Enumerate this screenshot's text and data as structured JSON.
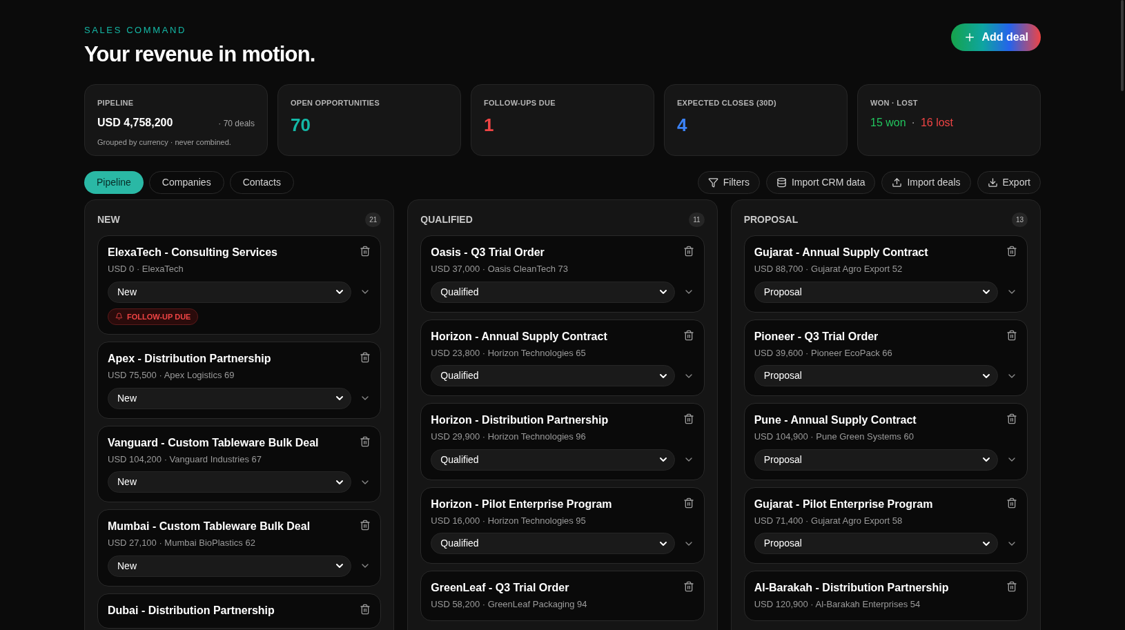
{
  "header": {
    "eyebrow": "SALES COMMAND",
    "title": "Your revenue in motion.",
    "add_button": "Add deal"
  },
  "stats": [
    {
      "kind": "pipeline",
      "label": "PIPELINE",
      "value": "USD 4,758,200",
      "aside": "· 70 deals",
      "note": "Grouped by currency · never combined."
    },
    {
      "kind": "number",
      "label": "OPEN OPPORTUNITIES",
      "value": "70",
      "color": "#14b8a6"
    },
    {
      "kind": "number",
      "label": "FOLLOW-UPS DUE",
      "value": "1",
      "color": "#ef4444"
    },
    {
      "kind": "number",
      "label": "EXPECTED CLOSES (30D)",
      "value": "4",
      "color": "#3b82f6"
    },
    {
      "kind": "split",
      "label": "WON · LOST",
      "parts": [
        {
          "text": "15 won",
          "color": "#22c55e"
        },
        {
          "text": "16 lost",
          "color": "#ef4444"
        }
      ],
      "separator": "·"
    }
  ],
  "tabs": [
    {
      "label": "Pipeline",
      "selected": true
    },
    {
      "label": "Companies",
      "selected": false
    },
    {
      "label": "Contacts",
      "selected": false
    }
  ],
  "actions": [
    {
      "kind": "filter",
      "label": "Filters"
    },
    {
      "kind": "database",
      "label": "Import CRM data"
    },
    {
      "kind": "upload",
      "label": "Import deals"
    },
    {
      "kind": "download",
      "label": "Export"
    }
  ],
  "columns": [
    {
      "name": "NEW",
      "count": "21",
      "deals": [
        {
          "title": "ElexaTech - Consulting Services",
          "meta": "USD 0 · ElexaTech",
          "stage": "New",
          "follow_up": "FOLLOW-UP DUE"
        },
        {
          "title": "Apex - Distribution Partnership",
          "meta": "USD 75,500 · Apex Logistics 69",
          "stage": "New"
        },
        {
          "title": "Vanguard - Custom Tableware Bulk Deal",
          "meta": "USD 104,200 · Vanguard Industries 67",
          "stage": "New"
        },
        {
          "title": "Mumbai - Custom Tableware Bulk Deal",
          "meta": "USD 27,100 · Mumbai BioPlastics 62",
          "stage": "New"
        },
        {
          "title": "Dubai - Distribution Partnership"
        }
      ]
    },
    {
      "name": "QUALIFIED",
      "count": "11",
      "deals": [
        {
          "title": "Oasis - Q3 Trial Order",
          "meta": "USD 37,000 · Oasis CleanTech 73",
          "stage": "Qualified"
        },
        {
          "title": "Horizon - Annual Supply Contract",
          "meta": "USD 23,800 · Horizon Technologies 65",
          "stage": "Qualified"
        },
        {
          "title": "Horizon - Distribution Partnership",
          "meta": "USD 29,900 · Horizon Technologies 96",
          "stage": "Qualified"
        },
        {
          "title": "Horizon - Pilot Enterprise Program",
          "meta": "USD 16,000 · Horizon Technologies 95",
          "stage": "Qualified"
        },
        {
          "title": "GreenLeaf - Q3 Trial Order",
          "meta": "USD 58,200 · GreenLeaf Packaging 94"
        }
      ]
    },
    {
      "name": "PROPOSAL",
      "count": "13",
      "deals": [
        {
          "title": "Gujarat - Annual Supply Contract",
          "meta": "USD 88,700 · Gujarat Agro Export 52",
          "stage": "Proposal"
        },
        {
          "title": "Pioneer - Q3 Trial Order",
          "meta": "USD 39,600 · Pioneer EcoPack 66",
          "stage": "Proposal"
        },
        {
          "title": "Pune - Annual Supply Contract",
          "meta": "USD 104,900 · Pune Green Systems 60",
          "stage": "Proposal"
        },
        {
          "title": "Gujarat - Pilot Enterprise Program",
          "meta": "USD 71,400 · Gujarat Agro Export 58",
          "stage": "Proposal"
        },
        {
          "title": "Al-Barakah - Distribution Partnership",
          "meta": "USD 120,900 · Al-Barakah Enterprises 54"
        }
      ]
    }
  ]
}
